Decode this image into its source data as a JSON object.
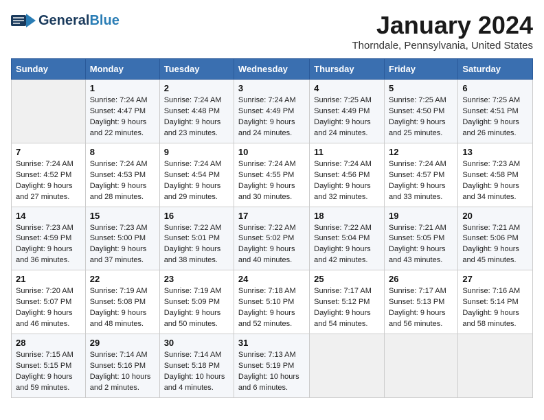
{
  "header": {
    "logo_general": "General",
    "logo_blue": "Blue",
    "month_title": "January 2024",
    "location": "Thorndale, Pennsylvania, United States"
  },
  "calendar": {
    "days_of_week": [
      "Sunday",
      "Monday",
      "Tuesday",
      "Wednesday",
      "Thursday",
      "Friday",
      "Saturday"
    ],
    "weeks": [
      [
        {
          "day": "",
          "info": ""
        },
        {
          "day": "1",
          "info": "Sunrise: 7:24 AM\nSunset: 4:47 PM\nDaylight: 9 hours\nand 22 minutes."
        },
        {
          "day": "2",
          "info": "Sunrise: 7:24 AM\nSunset: 4:48 PM\nDaylight: 9 hours\nand 23 minutes."
        },
        {
          "day": "3",
          "info": "Sunrise: 7:24 AM\nSunset: 4:49 PM\nDaylight: 9 hours\nand 24 minutes."
        },
        {
          "day": "4",
          "info": "Sunrise: 7:25 AM\nSunset: 4:49 PM\nDaylight: 9 hours\nand 24 minutes."
        },
        {
          "day": "5",
          "info": "Sunrise: 7:25 AM\nSunset: 4:50 PM\nDaylight: 9 hours\nand 25 minutes."
        },
        {
          "day": "6",
          "info": "Sunrise: 7:25 AM\nSunset: 4:51 PM\nDaylight: 9 hours\nand 26 minutes."
        }
      ],
      [
        {
          "day": "7",
          "info": "Sunrise: 7:24 AM\nSunset: 4:52 PM\nDaylight: 9 hours\nand 27 minutes."
        },
        {
          "day": "8",
          "info": "Sunrise: 7:24 AM\nSunset: 4:53 PM\nDaylight: 9 hours\nand 28 minutes."
        },
        {
          "day": "9",
          "info": "Sunrise: 7:24 AM\nSunset: 4:54 PM\nDaylight: 9 hours\nand 29 minutes."
        },
        {
          "day": "10",
          "info": "Sunrise: 7:24 AM\nSunset: 4:55 PM\nDaylight: 9 hours\nand 30 minutes."
        },
        {
          "day": "11",
          "info": "Sunrise: 7:24 AM\nSunset: 4:56 PM\nDaylight: 9 hours\nand 32 minutes."
        },
        {
          "day": "12",
          "info": "Sunrise: 7:24 AM\nSunset: 4:57 PM\nDaylight: 9 hours\nand 33 minutes."
        },
        {
          "day": "13",
          "info": "Sunrise: 7:23 AM\nSunset: 4:58 PM\nDaylight: 9 hours\nand 34 minutes."
        }
      ],
      [
        {
          "day": "14",
          "info": "Sunrise: 7:23 AM\nSunset: 4:59 PM\nDaylight: 9 hours\nand 36 minutes."
        },
        {
          "day": "15",
          "info": "Sunrise: 7:23 AM\nSunset: 5:00 PM\nDaylight: 9 hours\nand 37 minutes."
        },
        {
          "day": "16",
          "info": "Sunrise: 7:22 AM\nSunset: 5:01 PM\nDaylight: 9 hours\nand 38 minutes."
        },
        {
          "day": "17",
          "info": "Sunrise: 7:22 AM\nSunset: 5:02 PM\nDaylight: 9 hours\nand 40 minutes."
        },
        {
          "day": "18",
          "info": "Sunrise: 7:22 AM\nSunset: 5:04 PM\nDaylight: 9 hours\nand 42 minutes."
        },
        {
          "day": "19",
          "info": "Sunrise: 7:21 AM\nSunset: 5:05 PM\nDaylight: 9 hours\nand 43 minutes."
        },
        {
          "day": "20",
          "info": "Sunrise: 7:21 AM\nSunset: 5:06 PM\nDaylight: 9 hours\nand 45 minutes."
        }
      ],
      [
        {
          "day": "21",
          "info": "Sunrise: 7:20 AM\nSunset: 5:07 PM\nDaylight: 9 hours\nand 46 minutes."
        },
        {
          "day": "22",
          "info": "Sunrise: 7:19 AM\nSunset: 5:08 PM\nDaylight: 9 hours\nand 48 minutes."
        },
        {
          "day": "23",
          "info": "Sunrise: 7:19 AM\nSunset: 5:09 PM\nDaylight: 9 hours\nand 50 minutes."
        },
        {
          "day": "24",
          "info": "Sunrise: 7:18 AM\nSunset: 5:10 PM\nDaylight: 9 hours\nand 52 minutes."
        },
        {
          "day": "25",
          "info": "Sunrise: 7:17 AM\nSunset: 5:12 PM\nDaylight: 9 hours\nand 54 minutes."
        },
        {
          "day": "26",
          "info": "Sunrise: 7:17 AM\nSunset: 5:13 PM\nDaylight: 9 hours\nand 56 minutes."
        },
        {
          "day": "27",
          "info": "Sunrise: 7:16 AM\nSunset: 5:14 PM\nDaylight: 9 hours\nand 58 minutes."
        }
      ],
      [
        {
          "day": "28",
          "info": "Sunrise: 7:15 AM\nSunset: 5:15 PM\nDaylight: 9 hours\nand 59 minutes."
        },
        {
          "day": "29",
          "info": "Sunrise: 7:14 AM\nSunset: 5:16 PM\nDaylight: 10 hours\nand 2 minutes."
        },
        {
          "day": "30",
          "info": "Sunrise: 7:14 AM\nSunset: 5:18 PM\nDaylight: 10 hours\nand 4 minutes."
        },
        {
          "day": "31",
          "info": "Sunrise: 7:13 AM\nSunset: 5:19 PM\nDaylight: 10 hours\nand 6 minutes."
        },
        {
          "day": "",
          "info": ""
        },
        {
          "day": "",
          "info": ""
        },
        {
          "day": "",
          "info": ""
        }
      ]
    ]
  }
}
